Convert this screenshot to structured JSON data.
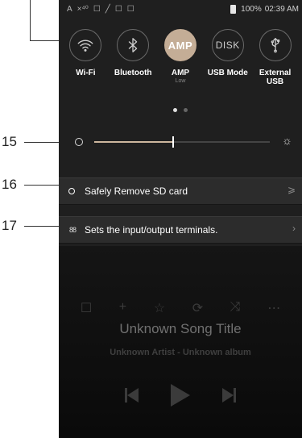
{
  "callouts": {
    "n15": "15",
    "n16": "16",
    "n17": "17"
  },
  "status": {
    "left_icons": [
      "A",
      "×⁴⁰",
      "☐",
      "╱",
      "☐",
      "☐"
    ],
    "battery": "100%",
    "time": "02:39 AM"
  },
  "toggles": [
    {
      "label": "Wi-Fi",
      "icon": "wifi-icon"
    },
    {
      "label": "Bluetooth",
      "icon": "bluetooth-icon"
    },
    {
      "label": "AMP",
      "icon_text": "AMP",
      "sublabel": "Low",
      "active": true
    },
    {
      "label": "USB Mode",
      "icon_text": "DISK"
    },
    {
      "label": "External\nUSB",
      "icon": "usb-icon"
    }
  ],
  "notifications": {
    "sd": {
      "text": "Safely Remove SD card",
      "tail": "⩾"
    },
    "io": {
      "text": "Sets the input/output terminals.",
      "tail": "›"
    }
  },
  "brightness": {
    "level": 0.45
  },
  "player": {
    "actions": [
      "☐",
      "+",
      "☆",
      "⟳",
      "⤨",
      "⋯"
    ],
    "title": "Unknown Song Title",
    "subtitle": "Unknown Artist - Unknown album"
  },
  "colors": {
    "accent": "#c4ad96",
    "panel": "#1f1f1f",
    "bar": "#2c2c2c"
  }
}
